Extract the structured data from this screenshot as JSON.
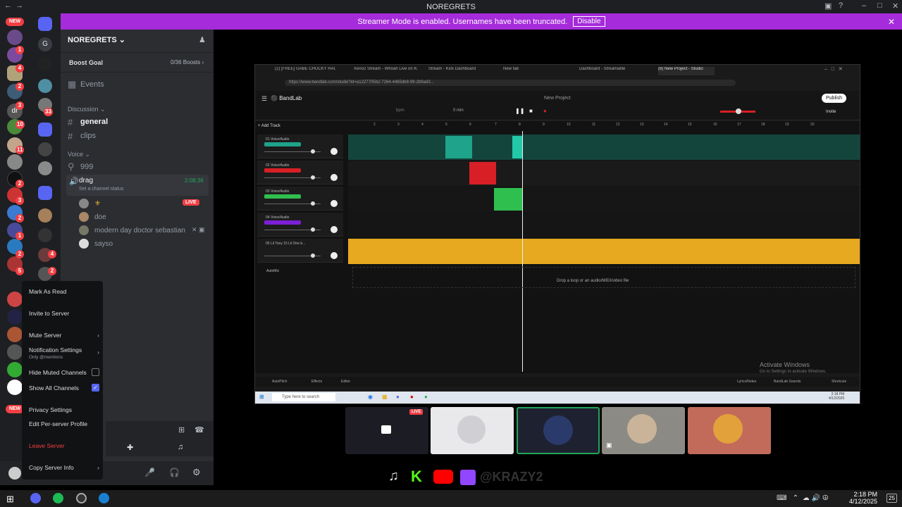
{
  "window": {
    "title": "NOREGRETS"
  },
  "banner": {
    "text": "Streamer Mode is enabled. Usernames have been truncated.",
    "button": "Disable"
  },
  "rail": {
    "new_label": "NEW",
    "letter_g": "G",
    "letter_dr": "dr",
    "badges": [
      "1",
      "4",
      "2",
      "3",
      "10",
      "33",
      "11",
      "2",
      "3",
      "2",
      "1",
      "4",
      "2",
      "2",
      "5"
    ]
  },
  "server": {
    "name": "NOREGRETS",
    "boost_goal": "Boost Goal",
    "boost_count": "0/36 Boosts"
  },
  "channels": {
    "events": "Events",
    "discussion_cat": "Discussion",
    "general": "general",
    "clips": "clips",
    "voice_cat": "Voice",
    "locked": "999",
    "drag": "drag",
    "drag_time": "2:08:36",
    "drag_status": "Set a channel status",
    "live": "LIVE",
    "users": [
      "doe",
      "modern day doctor sebastian",
      "sayso"
    ]
  },
  "context_menu": {
    "mark_read": "Mark As Read",
    "invite": "Invite to Server",
    "mute": "Mute Server",
    "notif": "Notification Settings",
    "notif_sub": "Only @mentions",
    "hide_muted": "Hide Muted Channels",
    "show_all": "Show All Channels",
    "privacy": "Privacy Settings",
    "edit_profile": "Edit Per-server Profile",
    "leave": "Leave Server",
    "copy_info": "Copy Server Info"
  },
  "browser": {
    "tabs": [
      "(2) [FREE] GABE CHUCKY HAUGH",
      "Xeno2 Stream - Whoah Live on Kick",
      "Stream - Kick Dashboard",
      "New tab",
      "Dashboard - Streamable",
      "(8) New Project - Studio"
    ],
    "url": "https://www.bandlab.com/studio?id=a1227705b2-7264-4465db8-99-2b9ad3...",
    "brand": "BandLab",
    "project": "New Project",
    "publish": "Publish",
    "invite": "Invite",
    "add_track": "Add Track",
    "bpm": "bpm",
    "min": "0 min",
    "tracks": [
      "01 Voice/Audio",
      "02 Voice/Audio",
      "03 Voice/Audio",
      "04 Voice/Audio",
      "05 Lil Tony 15 Lil One b..."
    ],
    "automix": "AutoMix",
    "drop_text": "Drop a loop or an audio/MIDI/video file",
    "bottom": [
      "AutoPitch",
      "Effects",
      "Editor",
      "Lyrics/Notes",
      "BandLab Sounds",
      "Shortcuts"
    ],
    "activate_title": "Activate Windows",
    "activate_sub": "Go to Settings to activate Windows.",
    "search": "Type here to search",
    "ruler": [
      "2",
      "3",
      "4",
      "5",
      "6",
      "7",
      "8",
      "9",
      "10",
      "11",
      "12",
      "13",
      "14",
      "15",
      "16",
      "17",
      "18",
      "19",
      "20"
    ],
    "clock_time": "2:18 PM",
    "clock_date": "4/12/2025"
  },
  "stream": {
    "live": "LIVE",
    "watermark": "@KRAZY2"
  },
  "taskbar": {
    "time": "2:18 PM",
    "date": "4/12/2025",
    "notif": "25"
  },
  "colors": {
    "accent": "#a52bdb",
    "teal": "#1fa38a",
    "red": "#d81f26",
    "gold": "#e6a91f",
    "purple": "#7d1fd6",
    "live": "#f23f43"
  }
}
